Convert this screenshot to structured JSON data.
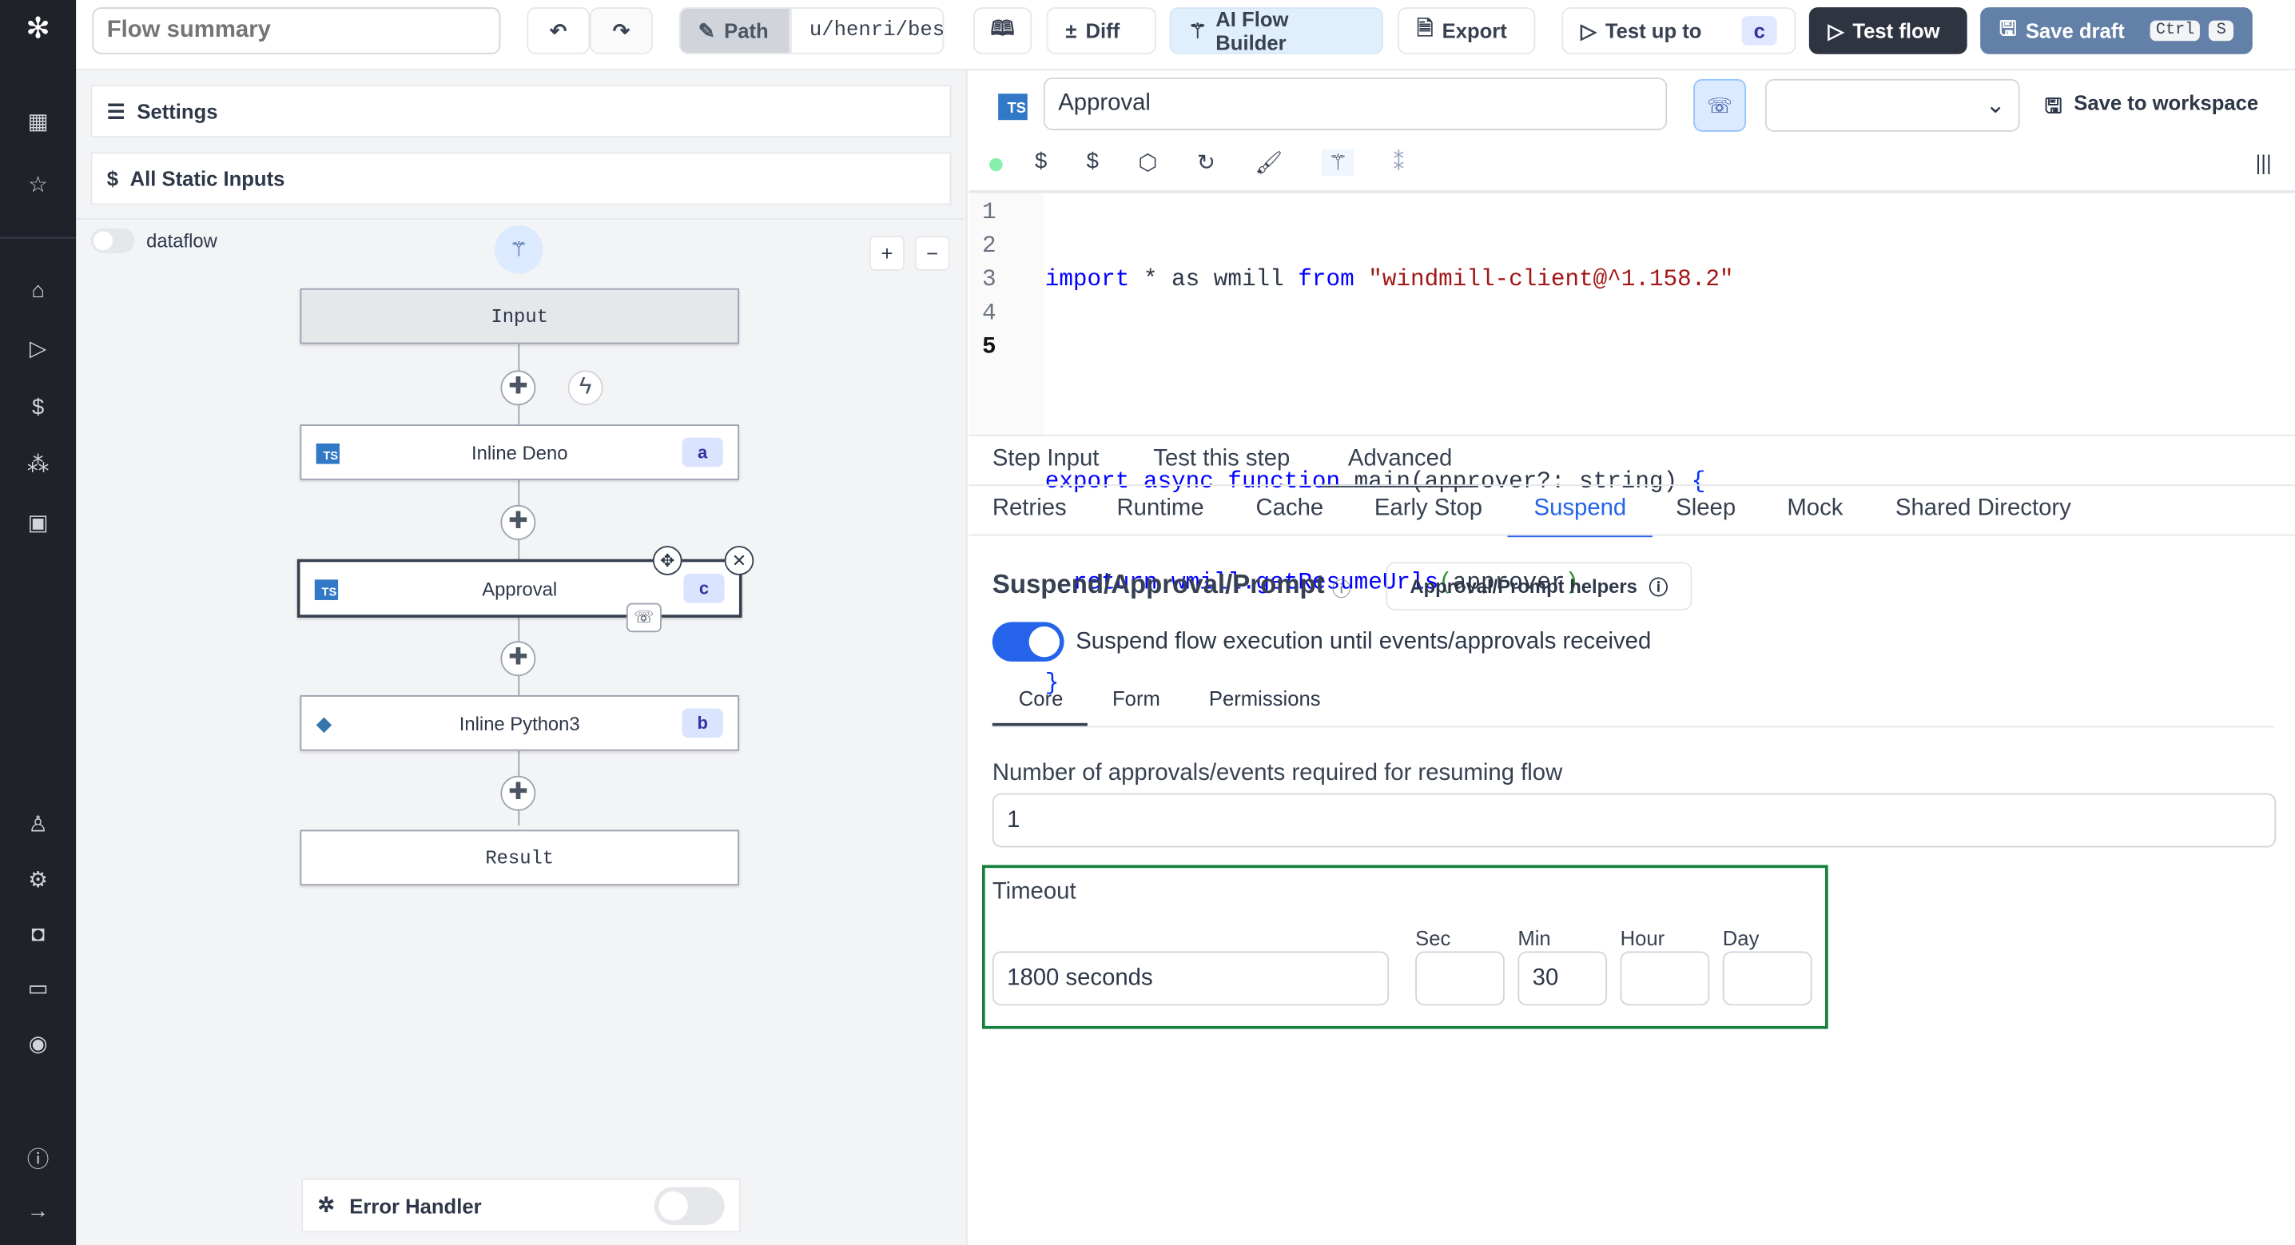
{
  "sidebar": {
    "icons": [
      "windmill-logo",
      "building-icon",
      "star-icon",
      "home-icon",
      "play-icon",
      "dollar-icon",
      "cluster-icon",
      "calendar-icon",
      "user-icon",
      "gear-icon",
      "bot-icon",
      "folder-icon",
      "eye-icon",
      "help-icon",
      "arrow-right-icon"
    ]
  },
  "topbar": {
    "summary_placeholder": "Flow summary",
    "path_label": "Path",
    "path_value": "u/henri/bes",
    "diff": "Diff",
    "ai_flow_builder": "AI Flow Builder",
    "export": "Export",
    "test_up_to": "Test up to",
    "test_up_to_badge": "c",
    "test_flow": "Test flow",
    "save_draft": "Save draft",
    "kbd_ctrl": "Ctrl",
    "kbd_s": "S"
  },
  "left": {
    "settings": "Settings",
    "static_inputs": "All Static Inputs",
    "dataflow": "dataflow",
    "dataflow_on": false,
    "nodes": [
      {
        "label": "Input"
      },
      {
        "label": "Inline Deno",
        "badge": "a"
      },
      {
        "label": "Approval",
        "badge": "c"
      },
      {
        "label": "Inline Python3",
        "badge": "b"
      },
      {
        "label": "Result"
      }
    ],
    "error_handler": "Error Handler",
    "error_handler_on": false
  },
  "editor": {
    "step_name": "Approval",
    "save_to_workspace": "Save to workspace",
    "lines": [
      {
        "n": "1"
      },
      {
        "n": "2"
      },
      {
        "n": "3"
      },
      {
        "n": "4"
      },
      {
        "n": "5"
      }
    ],
    "code": {
      "l1a": "import",
      "l1b": " * as wmill ",
      "l1c": "from",
      "l1d": " \"windmill-client@^1.158.2\"",
      "l3a": "export async function",
      "l3b": " main(approver?: string) ",
      "l3c": "{",
      "l4a": "  return wmill.getResumeUrls",
      "l4b": "(",
      "l4c": "approver",
      "l4d": ")",
      "l5": "}"
    }
  },
  "tabs": {
    "main": [
      "Step Input",
      "Test this step",
      "Advanced"
    ],
    "active_main": "Advanced",
    "advanced": [
      "Retries",
      "Runtime",
      "Cache",
      "Early Stop",
      "Suspend",
      "Sleep",
      "Mock",
      "Shared Directory"
    ],
    "active_advanced": "Suspend"
  },
  "suspend": {
    "title": "Suspend/Approval/Prompt",
    "helpers": "Approval/Prompt helpers",
    "toggle_label": "Suspend flow execution until events/approvals received",
    "toggle_on": true,
    "subtabs": [
      "Core",
      "Form",
      "Permissions"
    ],
    "active_subtab": "Core",
    "required_label": "Number of approvals/events required for resuming flow",
    "required_value": "1",
    "timeout_label": "Timeout",
    "timeout_value": "1800 seconds",
    "sec_label": "Sec",
    "min_label": "Min",
    "hour_label": "Hour",
    "day_label": "Day",
    "sec": "",
    "min": "30",
    "hour": "",
    "day": ""
  },
  "colors": {
    "accent": "#2563eb",
    "sidebar": "#1f2228",
    "highlight_border": "#15803d"
  }
}
